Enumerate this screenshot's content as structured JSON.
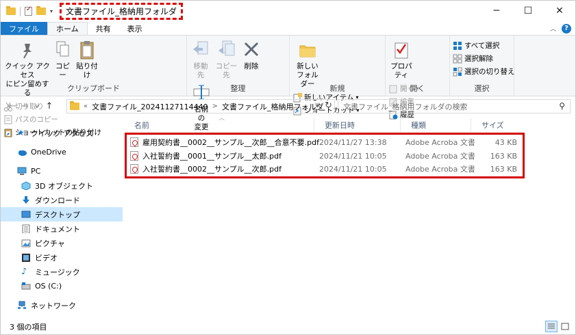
{
  "titlebar": {
    "title": "文書ファイル_格納用フォルダ",
    "minimize": "─",
    "maximize": "☐",
    "close": "✕"
  },
  "ribbon_tabs": {
    "file": "ファイル",
    "home": "ホーム",
    "share": "共有",
    "view": "表示",
    "help": "?"
  },
  "ribbon": {
    "clipboard": {
      "label": "クリップボード",
      "pin": "クイック アクセス\nにピン留めする",
      "copy": "コピー",
      "paste": "貼り付け",
      "cut": "切り取り",
      "copy_path": "パスのコピー",
      "paste_shortcut": "ショートカットの貼り付け"
    },
    "organize": {
      "label": "整理",
      "move_to": "移動先",
      "copy_to": "コピー先",
      "delete": "削除",
      "rename": "名前の\n変更"
    },
    "new": {
      "label": "新規",
      "new_folder": "新しい\nフォルダー",
      "new_item": "新しいアイテム",
      "shortcut": "ショートカット"
    },
    "open": {
      "label": "開く",
      "properties": "プロパティ",
      "open": "開く",
      "edit": "編集",
      "history": "履歴"
    },
    "select": {
      "label": "選択",
      "select_all": "すべて選択",
      "select_none": "選択解除",
      "invert": "選択の切り替え"
    }
  },
  "address": {
    "prefix": "«",
    "crumbs": [
      "文書ファイル_20241127114440",
      "文書ファイル_格納用フォルダ"
    ],
    "separator": ">",
    "search_placeholder": "文書ファイル_格納用フォルダの検索"
  },
  "nav": {
    "items": [
      {
        "label": "クイック アクセス"
      },
      {
        "label": "OneDrive"
      },
      {
        "label": "PC"
      },
      {
        "label": "3D オブジェクト"
      },
      {
        "label": "ダウンロード"
      },
      {
        "label": "デスクトップ"
      },
      {
        "label": "ドキュメント"
      },
      {
        "label": "ピクチャ"
      },
      {
        "label": "ビデオ"
      },
      {
        "label": "ミュージック"
      },
      {
        "label": "OS (C:)"
      },
      {
        "label": "ネットワーク"
      }
    ]
  },
  "columns": {
    "name": "名前",
    "date": "更新日時",
    "type": "種類",
    "size": "サイズ"
  },
  "files": [
    {
      "name": "雇用契約書__0002__サンプル__次郎__合意不要.pdf",
      "date": "2024/11/27 13:38",
      "type": "Adobe Acroba 文書",
      "size": "43 KB"
    },
    {
      "name": "入社誓約書__0001__サンプル__太郎.pdf",
      "date": "2024/11/21 10:05",
      "type": "Adobe Acroba 文書",
      "size": "163 KB"
    },
    {
      "name": "入社誓約書__0002__サンプル__次郎.pdf",
      "date": "2024/11/21 10:05",
      "type": "Adobe Acroba 文書",
      "size": "163 KB"
    }
  ],
  "status": {
    "count": "3 個の項目"
  },
  "colors": {
    "accent": "#1979ca",
    "highlight": "#d40000",
    "selection": "#cce8ff"
  }
}
